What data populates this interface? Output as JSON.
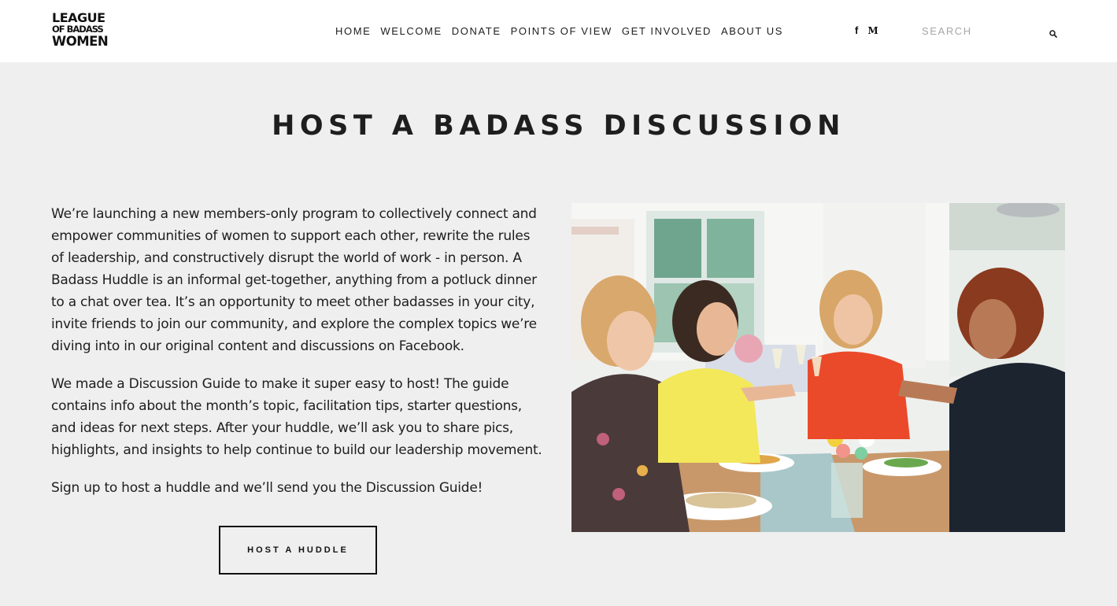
{
  "header": {
    "logo": {
      "line1": "League",
      "line2": "of Badass",
      "line3": "Women"
    },
    "nav": [
      "HOME",
      "WELCOME",
      "DONATE",
      "POINTS OF VIEW",
      "GET INVOLVED",
      "ABOUT US"
    ],
    "social": {
      "facebook": "f",
      "medium": "M"
    },
    "search": {
      "placeholder": "SEARCH",
      "icon": "search-icon"
    }
  },
  "main": {
    "title": "HOST A BADASS DISCUSSION",
    "paragraphs": [
      "We’re launching a new members-only program to collectively connect and empower communities of women to support each other, rewrite the rules of leadership, and constructively disrupt the world of work - in person. A Badass Huddle is an informal get-together, anything from a potluck dinner to a chat over tea. It’s an opportunity to meet other badasses in your city, invite friends to join our community, and explore the complex topics we’re diving into in our original content and discussions on Facebook.",
      "We made a Discussion Guide to make it super easy to host! The guide contains info about the month’s topic, facilitation tips, starter questions, and ideas for next steps. After your huddle, we’ll ask you to share pics, highlights, and insights to help continue to build our leadership movement.",
      "Sign up to host a huddle and we’ll send you the Discussion Guide!"
    ],
    "cta_label": "HOST A HUDDLE"
  },
  "colors": {
    "background": "#efefef",
    "header_bg": "#ffffff",
    "text": "#1e1e1e",
    "placeholder": "#a6a6a6"
  }
}
